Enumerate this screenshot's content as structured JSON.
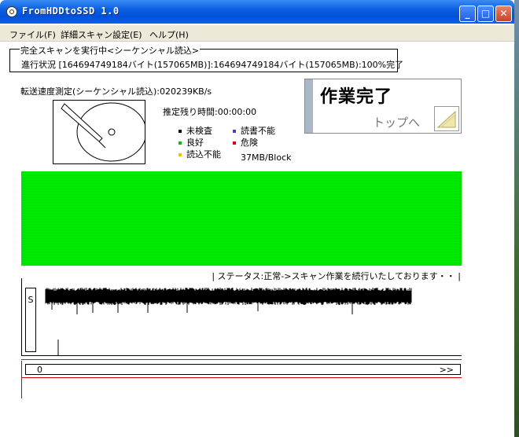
{
  "window": {
    "title": "FromHDDtoSSD  1.0",
    "minimize": "_",
    "maximize": "□",
    "close": "✕"
  },
  "menu": [
    "ファイル(F)",
    "詳細スキャン設定(E)",
    "ヘルプ(H)"
  ],
  "scan": {
    "frame_title": "完全スキャンを実行中<シーケンシャル読込>",
    "progress_text": "進行状況 [164694749184バイト(157065MB)]:164694749184バイト(157065MB):100%完了",
    "speed_text": "転送速度測定(シーケンシャル読込):020239KB/s",
    "remaining_text": "推定残り時間:00:00:00",
    "block_size": "37MB/Block"
  },
  "legend": [
    {
      "label": "未検査",
      "color": "#000000"
    },
    {
      "label": "読書不能",
      "color": "#4040c0"
    },
    {
      "label": "良好",
      "color": "#00c000"
    },
    {
      "label": "危険",
      "color": "#e00000"
    },
    {
      "label": "読込不能",
      "color": "#f0c000"
    }
  ],
  "done_panel": {
    "title": "作業完了",
    "link": "トップへ"
  },
  "status_text": "| ステータス:正常->スキャン作業を続行いたしております・・ |",
  "graph": {
    "label": "S"
  },
  "scroll": {
    "start": "0",
    "end": ">>"
  },
  "icons": {
    "app": "hdd-app-icon",
    "drive": "hdd-drive-icon",
    "corner": "folder-note-icon"
  }
}
